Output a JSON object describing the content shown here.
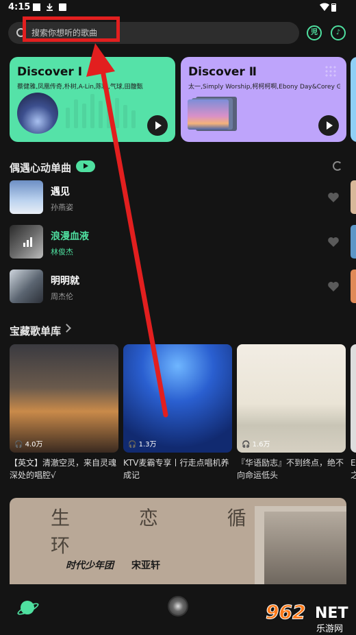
{
  "status_bar": {
    "time": "4:15"
  },
  "search": {
    "placeholder": "搜索你想听的歌曲"
  },
  "top_icons": [
    "mode-icon",
    "music-recognition-icon"
  ],
  "discover_cards": [
    {
      "title": "Discover Ⅰ",
      "subtitle": "蔡健雅,凤凰传奇,朴树,A-Lin,陈粒,气球,田馥甄"
    },
    {
      "title": "Discover Ⅱ",
      "subtitle": "太一,Simply Worship,柯柯柯啊,Ebony Day&Corey Gray,海..."
    }
  ],
  "section_songs": {
    "title": "偶遇心动单曲"
  },
  "songs": [
    {
      "name": "遇见",
      "artist": "孙燕姿",
      "playing": false
    },
    {
      "name": "浪漫血液",
      "artist": "林俊杰",
      "playing": true
    },
    {
      "name": "明明就",
      "artist": "周杰伦",
      "playing": false
    }
  ],
  "section_playlists": {
    "title": "宝藏歌单库"
  },
  "playlists": [
    {
      "count": "4.0万",
      "title": "【英文】清澈空灵，来自灵魂深处的唱腔√"
    },
    {
      "count": "1.3万",
      "title": "KTV麦霸专享丨行走点唱机养成记"
    },
    {
      "count": "1.6万",
      "title": "『华语励志』不到终点，绝不向命运低头"
    },
    {
      "count": "",
      "title": "E 之"
    }
  ],
  "banner": {
    "script": "生 恋 循 环",
    "brand": "时代少年团",
    "artist": "宋亚轩"
  },
  "watermark": {
    "number": "962",
    "net": "NET",
    "sub": "乐游网"
  },
  "colors": {
    "accent": "#4fe0a0",
    "card1": "#55e2a8",
    "card2": "#bea4fb",
    "annotation": "#e21f1f"
  }
}
